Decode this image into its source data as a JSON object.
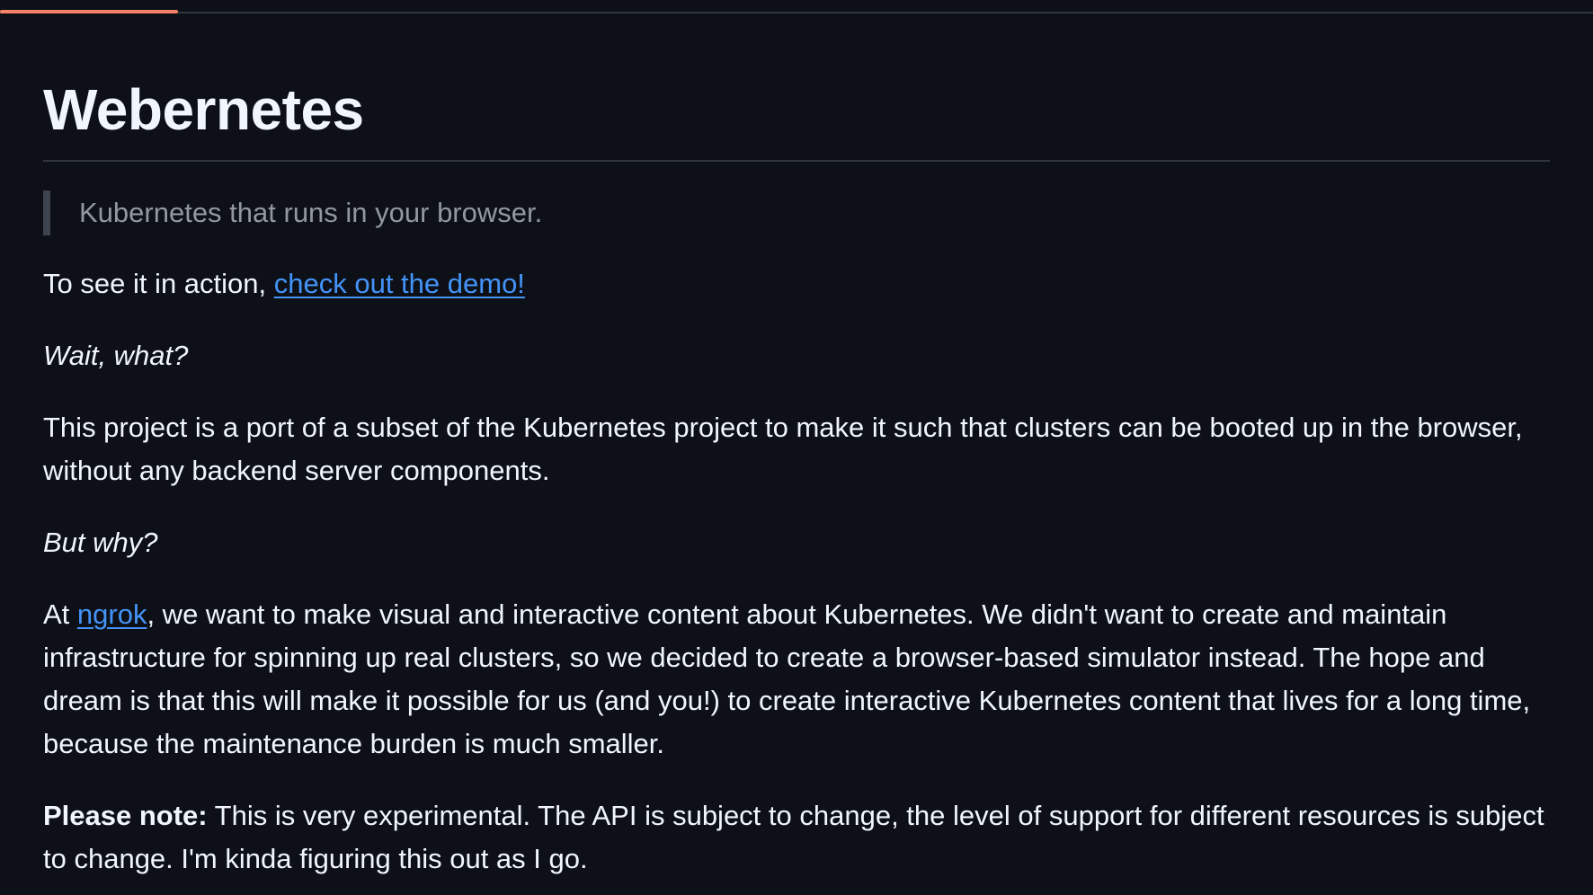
{
  "readme": {
    "title": "Webernetes",
    "tagline": "Kubernetes that runs in your browser.",
    "demo_intro": "To see it in action, ",
    "demo_link": "check out the demo!",
    "question_1": "Wait, what?",
    "answer_1": "This project is a port of a subset of the Kubernetes project to make it such that clusters can be booted up in the browser, without any backend server components.",
    "question_2": "But why?",
    "answer_2_prefix": "At ",
    "answer_2_link": "ngrok",
    "answer_2_rest": ", we want to make visual and interactive content about Kubernetes. We didn't want to create and maintain infrastructure for spinning up real clusters, so we decided to create a browser-based simulator instead. The hope and dream is that this will make it possible for us (and you!) to create interactive Kubernetes content that lives for a long time, because the maintenance burden is much smaller.",
    "note_label": "Please note:",
    "note_text": " This is very experimental. The API is subject to change, the level of support for different resources is subject to change. I'm kinda figuring this out as I go."
  },
  "colors": {
    "background": "#0d1117",
    "text": "#f0f6fc",
    "link": "#4493f8",
    "muted": "#9198a1",
    "accent": "#f78166"
  }
}
